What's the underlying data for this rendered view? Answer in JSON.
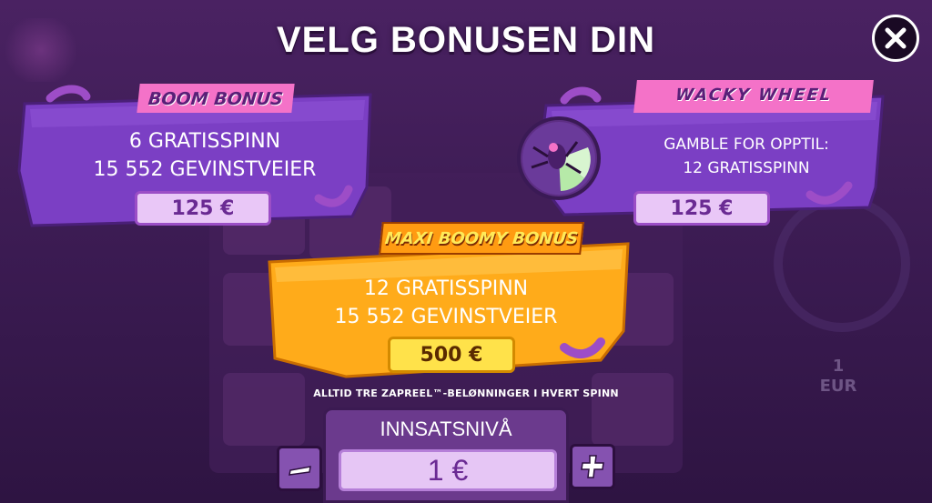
{
  "title": "VELG BONUSEN DIN",
  "close": {
    "icon": "close-icon"
  },
  "bonuses": {
    "boom": {
      "name": "BOOM BONUS",
      "line1": "6 GRATISSPINN",
      "line2": "15 552 GEVINSTVEIER",
      "price": "125 €"
    },
    "wacky": {
      "name": "WACKY  WHEEL",
      "line1": "GAMBLE FOR OPPTIL:",
      "line2": "12 GRATISSPINN",
      "price": "125 €"
    },
    "maxi": {
      "name": "MAXI BOOMY BONUS",
      "line1": "12 GRATISSPINN",
      "line2": "15 552 GEVINSTVEIER",
      "price": "500 €"
    }
  },
  "footnote": "ALLTID TRE ZAPREEL™-BELØNNINGER I HVERT SPINN",
  "bet": {
    "label": "INNSATSNIVÅ",
    "value": "1 €"
  },
  "background": {
    "balance_value": "1",
    "balance_unit": "EUR"
  },
  "colors": {
    "purple_panel": "#7b3fc4",
    "pink_badge": "#f472c8",
    "orange_panel": "#ffab1a",
    "price_button": "#e9c7f7",
    "maxi_price_button": "#ffe24a"
  }
}
